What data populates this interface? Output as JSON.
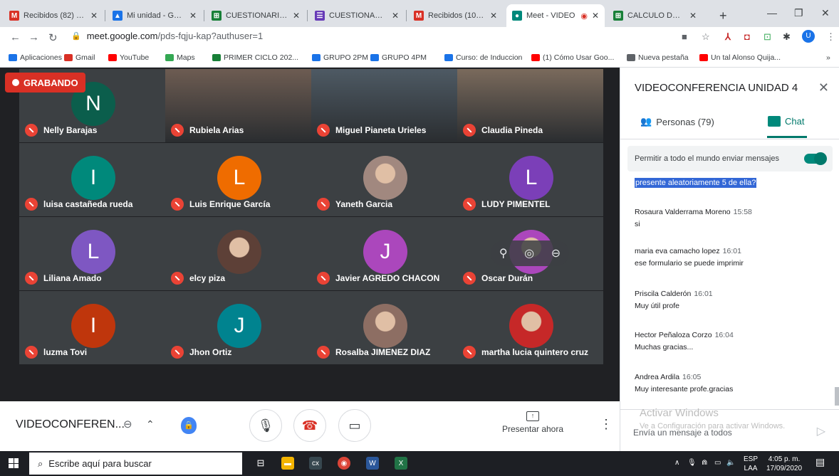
{
  "browser": {
    "tabs": [
      {
        "label": "Recibidos (82) - un",
        "icon": "gmail-icon",
        "color": "#d93025",
        "fav": "M"
      },
      {
        "label": "Mi unidad - Googl",
        "icon": "drive-icon",
        "color": "#1a73e8",
        "fav": "▲"
      },
      {
        "label": "CUESTIONARIO C",
        "icon": "classroom-icon",
        "color": "#188038",
        "fav": "⊞"
      },
      {
        "label": "CUESTIONARIO C",
        "icon": "forms-icon",
        "color": "#673ab7",
        "fav": "☰"
      },
      {
        "label": "Recibidos (10,624)",
        "icon": "gmail-icon",
        "color": "#d93025",
        "fav": "M"
      },
      {
        "label": "Meet - VIDEO",
        "icon": "meet-icon",
        "color": "#00897b",
        "fav": "●"
      },
      {
        "label": "CALCULO DE NOT",
        "icon": "classroom-icon",
        "color": "#188038",
        "fav": "⊞"
      }
    ],
    "url_host": "meet.google.com",
    "url_path": "/pds-fqju-kap?authuser=1",
    "bookmarks": [
      {
        "label": "Aplicaciones",
        "color": "#1a73e8"
      },
      {
        "label": "Gmail",
        "color": "#d93025"
      },
      {
        "label": "YouTube",
        "color": "#ff0000"
      },
      {
        "label": "Maps",
        "color": "#34a853"
      },
      {
        "label": "PRIMER CICLO 202...",
        "color": "#188038"
      },
      {
        "label": "GRUPO 2PM",
        "color": "#1a73e8"
      },
      {
        "label": "GRUPO 4PM",
        "color": "#1a73e8"
      },
      {
        "label": "Curso: de Induccion",
        "color": "#1a73e8"
      },
      {
        "label": "(1) Cómo Usar Goo...",
        "color": "#ff0000"
      },
      {
        "label": "Nueva pestaña",
        "color": "#5f6368"
      },
      {
        "label": "Un tal Alonso Quija...",
        "color": "#ff0000"
      }
    ]
  },
  "meet": {
    "recording_label": "GRABANDO",
    "participants": [
      {
        "name": "Nelly Barajas",
        "initial": "N",
        "color": "#0b5e4c"
      },
      {
        "name": "Rubiela Arias",
        "initial": "",
        "color": "#6d5c52"
      },
      {
        "name": "Miguel Pianeta Urieles",
        "initial": "",
        "color": "#4e5a64"
      },
      {
        "name": "Claudia Pineda",
        "initial": "",
        "color": "#7a6a5c"
      },
      {
        "name": "luisa castañeda rueda",
        "initial": "I",
        "color": "#00897b"
      },
      {
        "name": "Luis Enrique García",
        "initial": "L",
        "color": "#ef6c00"
      },
      {
        "name": "Yaneth Garcia",
        "initial": "",
        "color": "#a1887f"
      },
      {
        "name": "LUDY PIMENTEL",
        "initial": "L",
        "color": "#7b3fb8"
      },
      {
        "name": "Liliana Amado",
        "initial": "L",
        "color": "#7e57c2"
      },
      {
        "name": "elcy piza",
        "initial": "",
        "color": "#5d4037"
      },
      {
        "name": "Javier AGREDO CHACON",
        "initial": "J",
        "color": "#ab47bc"
      },
      {
        "name": "Oscar Durán",
        "initial": "",
        "color": "#ab47bc"
      },
      {
        "name": "luzma Tovi",
        "initial": "I",
        "color": "#bf360c"
      },
      {
        "name": "Jhon Ortiz",
        "initial": "J",
        "color": "#00838f"
      },
      {
        "name": "Rosalba JIMENEZ DIAZ",
        "initial": "",
        "color": "#8d6e63"
      },
      {
        "name": "martha lucia quintero cruz",
        "initial": "",
        "color": "#c62828"
      }
    ],
    "meeting_title": "VIDEOCONFEREN...",
    "present_label": "Presentar ahora"
  },
  "panel": {
    "title": "VIDEOCONFERENCIA UNIDAD 4",
    "people_tab": "Personas (79)",
    "chat_tab": "Chat",
    "allow_label": "Permitir a todo el mundo enviar mensajes",
    "selected_text": "presente aleatoriamente 5 de ella?",
    "messages": [
      {
        "author": "Rosaura Valderrama Moreno",
        "time": "15:58",
        "text": "si"
      },
      {
        "author": "maria eva camacho lopez",
        "time": "16:01",
        "text": "ese formulario se puede imprimir"
      },
      {
        "author": "Priscila Calderón",
        "time": "16:01",
        "text": "Muy útil profe"
      },
      {
        "author": "Hector Peñaloza Corzo",
        "time": "16:04",
        "text": "Muchas  gracias..."
      },
      {
        "author": "Andrea Ardila",
        "time": "16:05",
        "text": "Muy interesante profe.gracias"
      }
    ],
    "input_placeholder": "Envía un mensaje a todos",
    "watermark_1": "Activar Windows",
    "watermark_2": "Ve a Configuración para activar Windows."
  },
  "taskbar": {
    "search_placeholder": "Escribe aquí para buscar",
    "lang": "ESP",
    "lang2": "LAA",
    "time": "4:05 p. m.",
    "date": "17/09/2020"
  }
}
